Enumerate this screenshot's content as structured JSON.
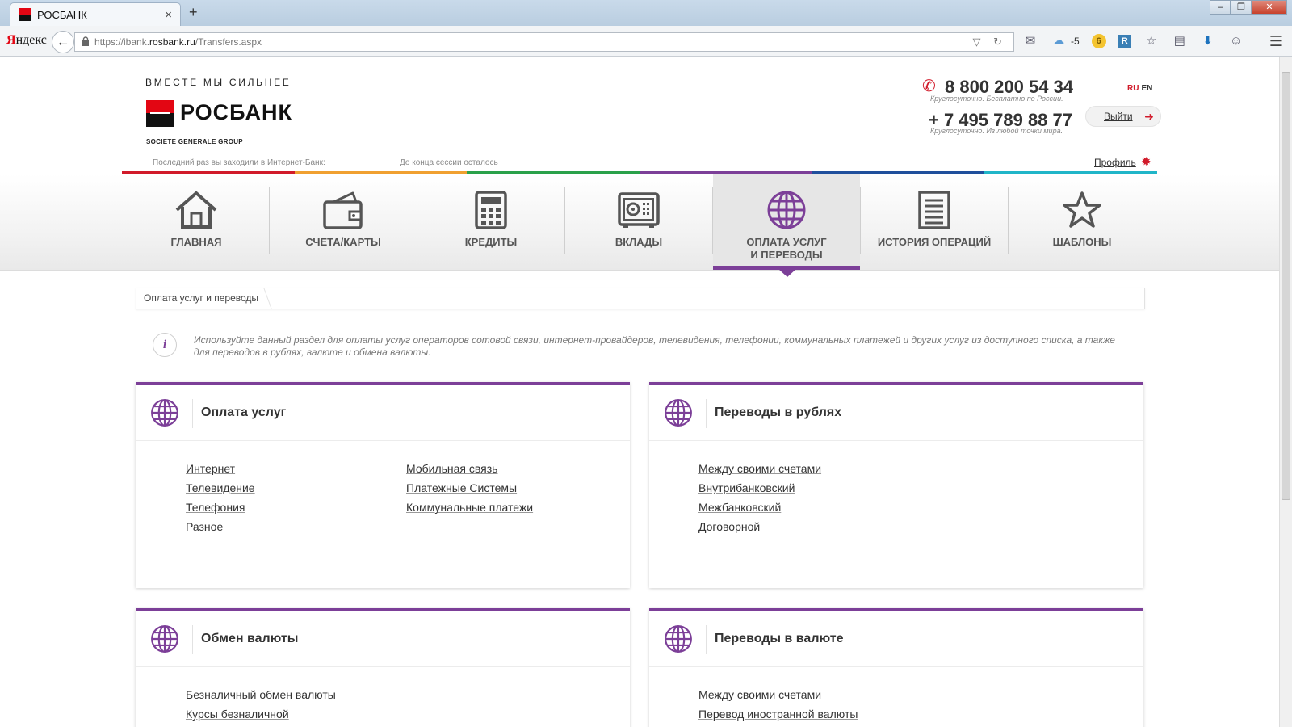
{
  "browser": {
    "tab_title": "РОСБАНК",
    "tab_close": "×",
    "new_tab": "+",
    "yandex_label_first": "Я",
    "yandex_label_rest": "ндекс",
    "back": "←",
    "url_prefix": "https://ibank.",
    "url_domain": "rosbank.ru",
    "url_path": "/Transfers.aspx",
    "url_tools": "▽ ↻",
    "weather": "-5",
    "coin_label": "6",
    "r_label": "R",
    "win_min": "–",
    "win_max": "❐",
    "win_close": "✕",
    "menu": "☰"
  },
  "header": {
    "slogan": "ВМЕСТЕ МЫ СИЛЬНЕЕ",
    "logo_text": "РОСБАНК",
    "logo_sub": "SOCIETE GENERALE GROUP",
    "phone_icon": "✆",
    "phone1": "8 800 200 54 34",
    "phone1_note": "Круглосуточно. Бесплатно по России.",
    "phone2": "+ 7 495 789 88 77",
    "phone2_note": "Круглосуточно. Из любой точки мира.",
    "lang_ru": "RU",
    "lang_en": "EN",
    "logout": "Выйти",
    "logout_arrow": "➜",
    "last_visit": "Последний раз вы заходили в Интернет-Банк:",
    "session_left": "До конца сессии осталось",
    "profile": "Профиль",
    "profile_gear": "✹"
  },
  "colors": {
    "accent": "#7c3f98",
    "brand_red": "#e30613",
    "bar": [
      "#d11a2a",
      "#f0a030",
      "#2aa14a",
      "#7c3f98",
      "#1f4f9c",
      "#20b5c8"
    ]
  },
  "nav": {
    "items": [
      {
        "label": "ГЛАВНАЯ",
        "icon": "home-icon"
      },
      {
        "label": "СЧЕТА/КАРТЫ",
        "icon": "wallet-icon"
      },
      {
        "label": "КРЕДИТЫ",
        "icon": "calculator-icon"
      },
      {
        "label": "ВКЛАДЫ",
        "icon": "safe-icon"
      },
      {
        "label1": "ОПЛАТА УСЛУГ",
        "label2": "И ПЕРЕВОДЫ",
        "icon": "globe-icon",
        "active": true
      },
      {
        "label": "ИСТОРИЯ ОПЕРАЦИЙ",
        "icon": "document-icon"
      },
      {
        "label": "ШАБЛОНЫ",
        "icon": "star-icon"
      }
    ]
  },
  "breadcrumb": "Оплата услуг и переводы",
  "info": {
    "icon": "i",
    "text": "Используйте данный раздел для оплаты услуг операторов сотовой связи, интернет-провайдеров, телевидения, телефонии, коммунальных платежей и других услуг из доступного списка, а также для переводов в рублях, валюте и обмена валюты."
  },
  "cards": {
    "services": {
      "title": "Оплата услуг",
      "col1": [
        "Интернет",
        "Телевидение",
        "Телефония",
        "Разное"
      ],
      "col2": [
        "Мобильная связь",
        "Платежные Системы",
        "Коммунальные платежи"
      ]
    },
    "rub": {
      "title": "Переводы в рублях",
      "col1": [
        "Между своими счетами",
        "Внутрибанковский",
        "Межбанковский",
        "Договорной"
      ]
    },
    "exchange": {
      "title": "Обмен валюты",
      "col1": [
        "Безналичный обмен валюты",
        "Курсы безналичной"
      ]
    },
    "fx": {
      "title": "Переводы в валюте",
      "col1": [
        "Между своими счетами",
        "Перевод иностранной валюты"
      ]
    }
  }
}
